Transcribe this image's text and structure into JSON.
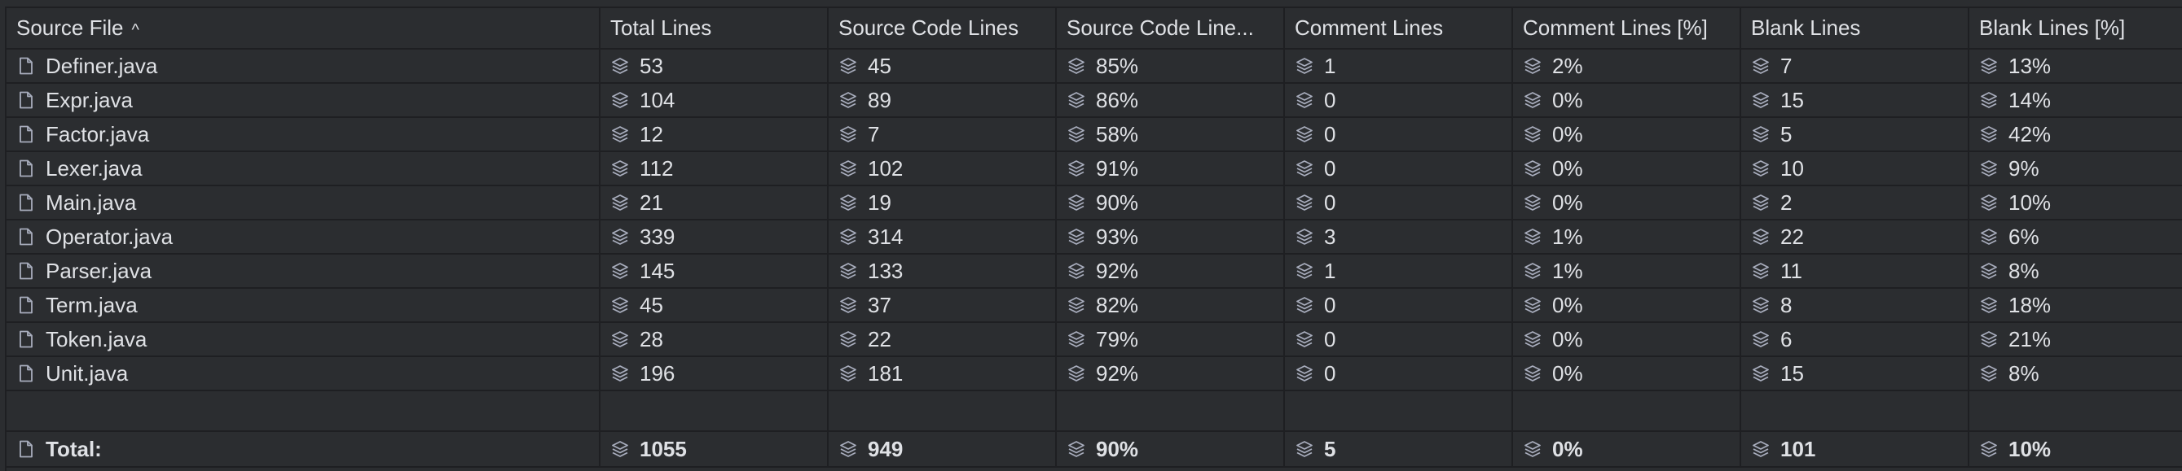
{
  "columns": [
    "Source File",
    "Total Lines",
    "Source Code Lines",
    "Source Code Line...",
    "Comment Lines",
    "Comment Lines [%]",
    "Blank Lines",
    "Blank Lines [%]"
  ],
  "rows": [
    {
      "file": "Definer.java",
      "total": "53",
      "source": "45",
      "source_pct": "85%",
      "comment": "1",
      "comment_pct": "2%",
      "blank": "7",
      "blank_pct": "13%"
    },
    {
      "file": "Expr.java",
      "total": "104",
      "source": "89",
      "source_pct": "86%",
      "comment": "0",
      "comment_pct": "0%",
      "blank": "15",
      "blank_pct": "14%"
    },
    {
      "file": "Factor.java",
      "total": "12",
      "source": "7",
      "source_pct": "58%",
      "comment": "0",
      "comment_pct": "0%",
      "blank": "5",
      "blank_pct": "42%"
    },
    {
      "file": "Lexer.java",
      "total": "112",
      "source": "102",
      "source_pct": "91%",
      "comment": "0",
      "comment_pct": "0%",
      "blank": "10",
      "blank_pct": "9%"
    },
    {
      "file": "Main.java",
      "total": "21",
      "source": "19",
      "source_pct": "90%",
      "comment": "0",
      "comment_pct": "0%",
      "blank": "2",
      "blank_pct": "10%"
    },
    {
      "file": "Operator.java",
      "total": "339",
      "source": "314",
      "source_pct": "93%",
      "comment": "3",
      "comment_pct": "1%",
      "blank": "22",
      "blank_pct": "6%"
    },
    {
      "file": "Parser.java",
      "total": "145",
      "source": "133",
      "source_pct": "92%",
      "comment": "1",
      "comment_pct": "1%",
      "blank": "11",
      "blank_pct": "8%"
    },
    {
      "file": "Term.java",
      "total": "45",
      "source": "37",
      "source_pct": "82%",
      "comment": "0",
      "comment_pct": "0%",
      "blank": "8",
      "blank_pct": "18%"
    },
    {
      "file": "Token.java",
      "total": "28",
      "source": "22",
      "source_pct": "79%",
      "comment": "0",
      "comment_pct": "0%",
      "blank": "6",
      "blank_pct": "21%"
    },
    {
      "file": "Unit.java",
      "total": "196",
      "source": "181",
      "source_pct": "92%",
      "comment": "0",
      "comment_pct": "0%",
      "blank": "15",
      "blank_pct": "8%"
    }
  ],
  "total": {
    "file": "Total:",
    "total": "1055",
    "source": "949",
    "source_pct": "90%",
    "comment": "5",
    "comment_pct": "0%",
    "blank": "101",
    "blank_pct": "10%"
  },
  "sort": {
    "column": "Source File",
    "direction_icon": "chevron-up-icon",
    "glyph": "^"
  },
  "icons": {
    "file": "file-icon",
    "metric": "layers-icon"
  },
  "colors": {
    "background": "#2b2d30",
    "grid": "#1e1f22",
    "text": "#dfe1e5",
    "icon": "#a8adbd"
  }
}
